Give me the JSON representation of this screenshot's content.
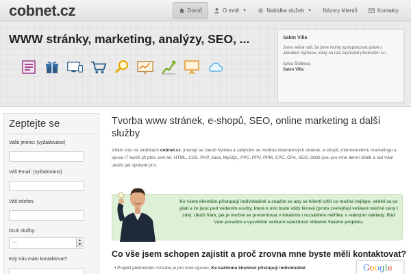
{
  "brand": {
    "logo": "cobnet.cz"
  },
  "nav": {
    "items": [
      {
        "label": "Domů",
        "icon": "home-icon",
        "active": true
      },
      {
        "label": "O mně",
        "icon": "user-icon",
        "caret": true
      },
      {
        "label": "Nabídka služeb",
        "icon": "gear-icon",
        "caret": true
      },
      {
        "label": "Názory klientů",
        "icon": "",
        "caret": false
      },
      {
        "label": "Kontakty",
        "icon": "mail-icon",
        "caret": false
      }
    ]
  },
  "hero": {
    "title": "WWW stránky, marketing, analýzy, SEO, ...",
    "icons": [
      "web-page-icon",
      "gift-box-icon",
      "devices-icon",
      "shopping-cart-icon",
      "magnifier-icon",
      "analytics-board-icon",
      "growth-chart-icon",
      "presentation-icon",
      "cloud-icon"
    ],
    "testimonial": {
      "title": "Salon Villa",
      "text": "Jsme velice rádi, že jsme mohly spolupracovat právě s Jakubem Vytiskou, který na nás zapůsobil především sv...",
      "author": "Sylva Šrůtková",
      "company": "Salon Villa"
    }
  },
  "sidebar": {
    "title": "Zeptejte se",
    "fields": {
      "name": {
        "label": "Vaše jméno: (vyžadováno)",
        "value": ""
      },
      "email": {
        "label": "Váš Email: (vyžadováno)",
        "value": ""
      },
      "phone": {
        "label": "Váš telefon:",
        "value": ""
      },
      "service": {
        "label": "Druh služby:",
        "value": "---"
      },
      "contact_time": {
        "label": "Kdy Vás mám kontaktovat?",
        "value": ""
      }
    }
  },
  "main": {
    "title": "Tvorba www stránek, e-shopů, SEO, online marketing a další služby",
    "intro_pre": "Vítám Vás na stránkách ",
    "intro_brand": "cobnet.cz",
    "intro_post": ", jmenuji se Jakub Vytiska a zabývám se tvorbou internetových stránek, e-shopů, internetovému marketingu a výuce IT kurzů již přes osm let. HTML, CSS, PHP, Java, MySQL, PPC, PPV, PPM, CPC,  CPA, SEO, SMO jsou pro mne denní chléb a rád Vám ukážu jak správně píct.",
    "callout": "Ke všem klientům přistupuji individuálně a snažím se aby se klienti cítili  co možná nejlépe, věděli za co platí a že jsou pod vedením osoby, která k nim bude vždy férová (proto zveřejňují veškeré možné ceny i zde). Ukáží Vám, jak je možné se prezentovat v lokálním i rozsáhlém měřítku s reálnými náklady. Rád Vám poradím a vysvětlím veškeré náležitosti ohledně Vašeho projektu.",
    "subtitle": "Co vše jsem schopen zajistit a proč zrovna mne byste měli kontaktovat?",
    "bullet_pre": "Projekt jakéhokoliv rozsahu je pro mne výzvou. ",
    "bullet_bold": "Ke každému klientovi přistupuji individuálně."
  },
  "google_badge": "Google",
  "colors": {
    "accent_green": "#3c763d",
    "callout_bg": "#dff0d8",
    "hero_bg": "#ebebeb"
  }
}
